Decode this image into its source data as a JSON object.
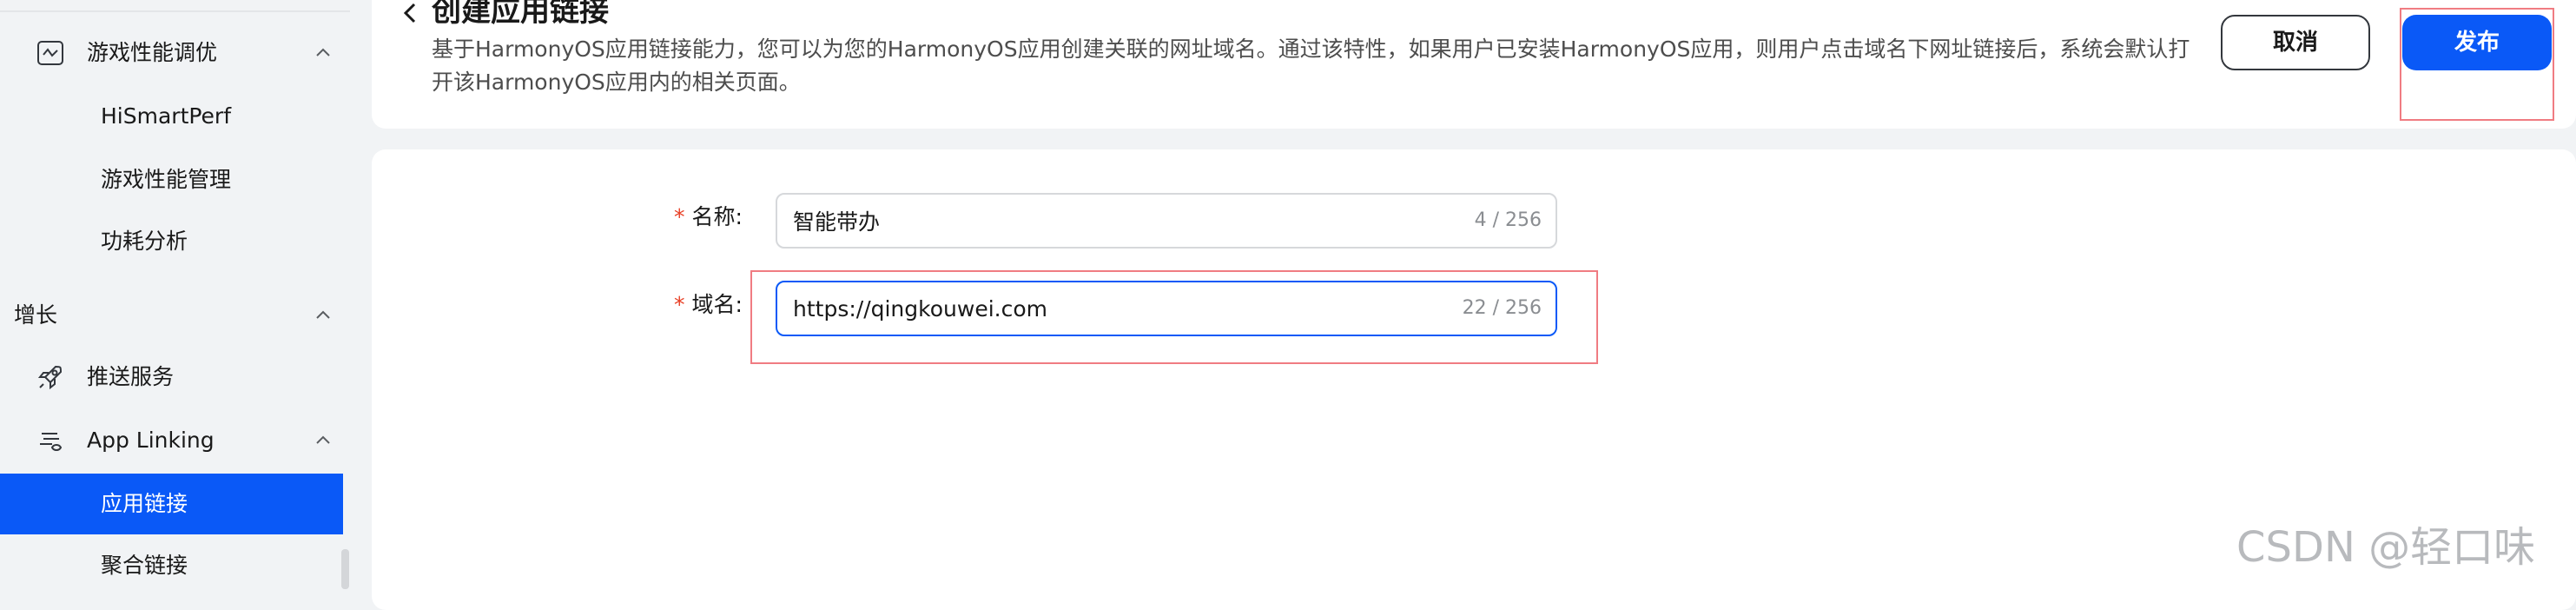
{
  "sidebar": {
    "items": [
      {
        "label": "游戏性能调优",
        "level": 1,
        "icon": "performance-icon",
        "expanded": true
      },
      {
        "label": "HiSmartPerf",
        "level": 2
      },
      {
        "label": "游戏性能管理",
        "level": 2
      },
      {
        "label": "功耗分析",
        "level": 2
      },
      {
        "label": "增长",
        "level": 0,
        "expanded": true
      },
      {
        "label": "推送服务",
        "level": 1,
        "icon": "rocket-icon"
      },
      {
        "label": "App Linking",
        "level": 1,
        "icon": "link-icon",
        "expanded": true
      },
      {
        "label": "应用链接",
        "level": 2,
        "active": true
      },
      {
        "label": "聚合链接",
        "level": 2
      }
    ]
  },
  "header": {
    "back_icon": "chevron-left-icon",
    "title": "创建应用链接",
    "description": "基于HarmonyOS应用链接能力，您可以为您的HarmonyOS应用创建关联的网址域名。通过该特性，如果用户已安装HarmonyOS应用，则用户点击域名下网址链接后，系统会默认打开该HarmonyOS应用内的相关页面。",
    "cancel_label": "取消",
    "publish_label": "发布"
  },
  "form": {
    "name": {
      "required_mark": "*",
      "label": "名称:",
      "value": "智能带办",
      "counter": "4 / 256"
    },
    "domain": {
      "required_mark": "*",
      "label": "域名:",
      "value": "https://qingkouwei.com",
      "counter": "22 / 256"
    }
  },
  "watermark": "CSDN @轻口味",
  "colors": {
    "accent": "#0a59f7",
    "required": "#e84026",
    "highlight_box": "#f07c82"
  }
}
